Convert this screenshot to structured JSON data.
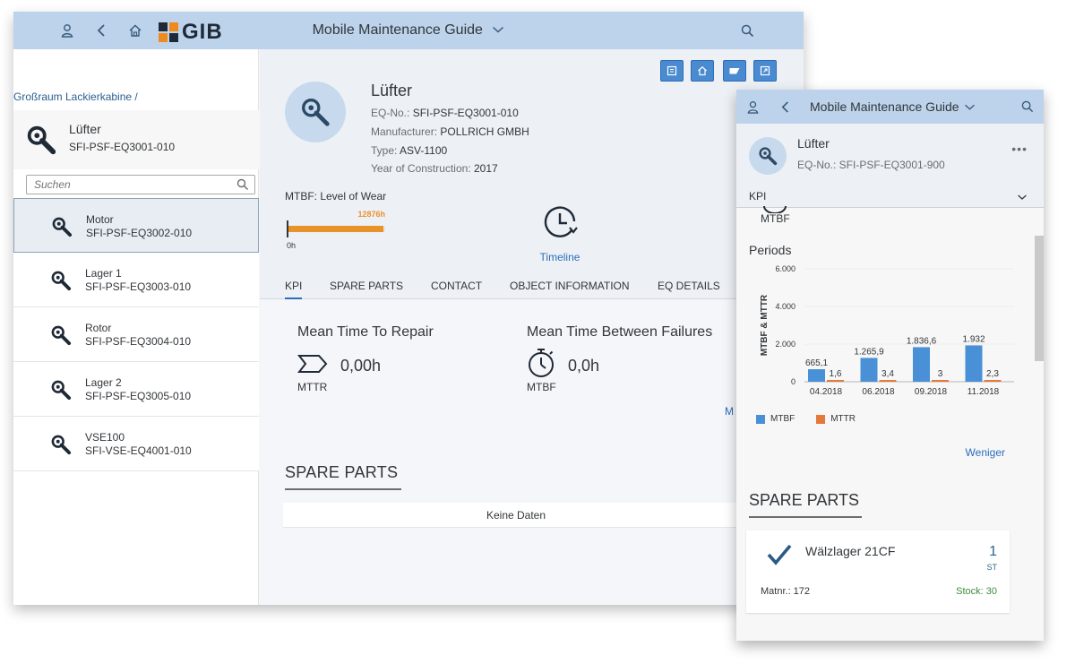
{
  "desktop": {
    "shell": {
      "title": "Mobile Maintenance Guide",
      "logo_text": "GIB"
    },
    "master": {
      "breadcrumb": "Großraum Lackierkabine /",
      "header": {
        "name": "Lüfter",
        "id": "SFI-PSF-EQ3001-010"
      },
      "search_placeholder": "Suchen",
      "items": [
        {
          "name": "Motor",
          "id": "SFI-PSF-EQ3002-010"
        },
        {
          "name": "Lager 1",
          "id": "SFI-PSF-EQ3003-010"
        },
        {
          "name": "Rotor",
          "id": "SFI-PSF-EQ3004-010"
        },
        {
          "name": "Lager 2",
          "id": "SFI-PSF-EQ3005-010"
        },
        {
          "name": "VSE100",
          "id": "SFI-VSE-EQ4001-010"
        }
      ]
    },
    "detail": {
      "title": "Lüfter",
      "eq_label": "EQ-No.:",
      "eq_value": "SFI-PSF-EQ3001-010",
      "manufacturer_label": "Manufacturer:",
      "manufacturer_value": "POLLRICH GMBH",
      "type_label": "Type:",
      "type_value": "ASV-1100",
      "year_label": "Year of Construction:",
      "year_value": "2017",
      "mtbf_label": "MTBF: Level of Wear",
      "mtbf_value": "12876h",
      "mtbf_zero": "0h",
      "mtbf_fill_fraction": 0.98,
      "timeline_label": "Timeline",
      "tabs": [
        "KPI",
        "SPARE PARTS",
        "CONTACT",
        "OBJECT INFORMATION",
        "EQ DETAILS"
      ],
      "kpi": {
        "mttr_title": "Mean Time To Repair",
        "mttr_value": "0,00h",
        "mttr_sub": "MTTR",
        "mtbf_title": "Mean Time Between Failures",
        "mtbf_value": "0,0h",
        "mtbf_sub": "MTBF",
        "more": "M"
      },
      "spare_parts_title": "SPARE PARTS",
      "no_data": "Keine Daten"
    }
  },
  "mobile": {
    "shell": {
      "title": "Mobile Maintenance Guide"
    },
    "header": {
      "title": "Lüfter",
      "subtitle": "EQ-No.: SFI-PSF-EQ3001-900",
      "more": "•••"
    },
    "kpi_select": "KPI",
    "mtbf_partial": "MTBF",
    "periods_title": "Periods",
    "less_link": "Weniger",
    "spare_parts_title": "SPARE PARTS",
    "card": {
      "name": "Wälzlager 21CF",
      "qty": "1",
      "unit": "ST",
      "matnr": "Matnr.: 172",
      "stock": "Stock: 30"
    }
  },
  "chart_data": {
    "type": "bar",
    "ylabel": "MTBF & MTTR",
    "ylim": [
      0,
      6000
    ],
    "yticks": [
      "0",
      "2.000",
      "4.000",
      "6.000"
    ],
    "categories": [
      "04.2018",
      "06.2018",
      "09.2018",
      "11.2018"
    ],
    "series": [
      {
        "name": "MTBF",
        "values": [
          665.1,
          1265.9,
          1836.6,
          1932
        ],
        "labels": [
          "665,1",
          "1.265,9",
          "1.836,6",
          "1.932"
        ],
        "color": "#4a90d6"
      },
      {
        "name": "MTTR",
        "values": [
          1.6,
          3.4,
          3,
          2.3
        ],
        "labels": [
          "1,6",
          "3,4",
          "3",
          "2,3"
        ],
        "color": "#e4793a"
      }
    ],
    "legend": "bottom-left"
  },
  "colors": {
    "shell": "#bcd3eb",
    "accent": "#2a6ebb",
    "mtbf_bar": "#e9922a",
    "stock": "#3d8b3d"
  }
}
